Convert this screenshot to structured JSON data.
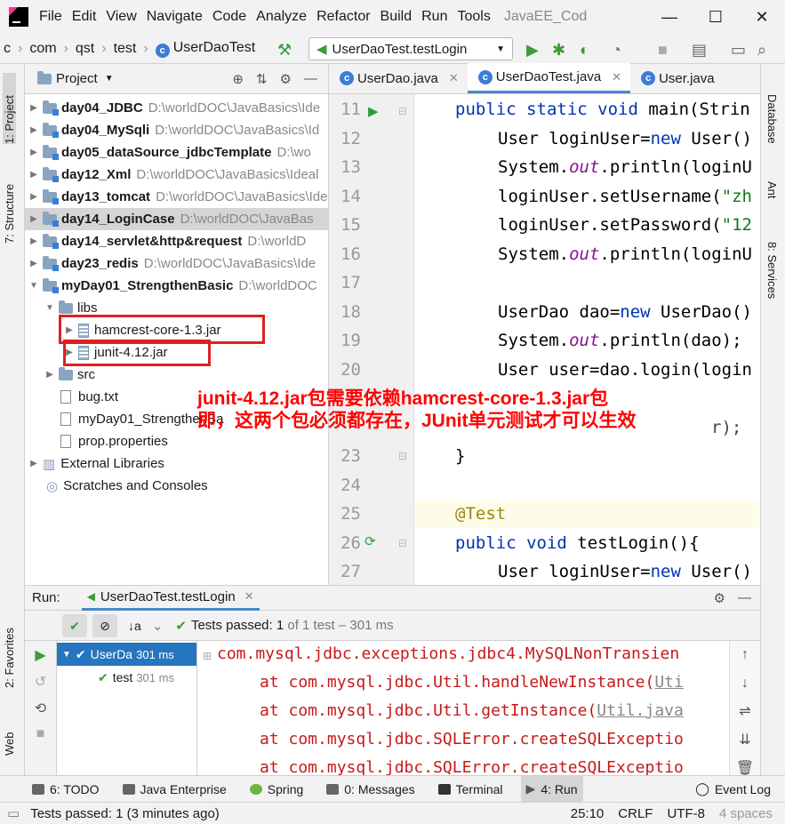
{
  "titlebar": {
    "menu": [
      "File",
      "Edit",
      "View",
      "Navigate",
      "Code",
      "Analyze",
      "Refactor",
      "Build",
      "Run",
      "Tools"
    ],
    "window_title": "JavaEE_Cod",
    "minimize": "—",
    "maximize": "☐",
    "close": "✕"
  },
  "navbar": {
    "crumbs": [
      "c",
      "com",
      "qst",
      "test",
      "UserDaoTest"
    ],
    "run_config": "UserDaoTest.testLogin"
  },
  "left_strip": {
    "project_tab": "1: Project",
    "structure_tab": "7: Structure",
    "favorites_tab": "2: Favorites",
    "web_tab": "Web"
  },
  "right_strip": {
    "database_tab": "Database",
    "ant_tab": "Ant",
    "services_tab": "8: Services"
  },
  "project": {
    "header": "Project",
    "items": [
      {
        "name": "day04_JDBC",
        "path": "D:\\worldDOC\\JavaBasics\\Ide"
      },
      {
        "name": "day04_MySqli",
        "path": "D:\\worldDOC\\JavaBasics\\Id"
      },
      {
        "name": "day05_dataSource_jdbcTemplate",
        "path": "D:\\wo"
      },
      {
        "name": "day12_Xml",
        "path": "D:\\worldDOC\\JavaBasics\\Ideal"
      },
      {
        "name": "day13_tomcat",
        "path": "D:\\worldDOC\\JavaBasics\\Ide"
      },
      {
        "name": "day14_LoginCase",
        "path": "D:\\worldDOC\\JavaBas"
      },
      {
        "name": "day14_servlet&http&request",
        "path": "D:\\worldD"
      },
      {
        "name": "day23_redis",
        "path": "D:\\worldDOC\\JavaBasics\\Ide"
      },
      {
        "name": "myDay01_StrengthenBasic",
        "path": "D:\\worldDOC"
      }
    ],
    "libs": "libs",
    "jar1": "hamcrest-core-1.3.jar",
    "jar2": "junit-4.12.jar",
    "src": "src",
    "bug": "bug.txt",
    "iml": "myDay01_StrengthenBa",
    "prop": "prop.properties",
    "external": "External Libraries",
    "scratches": "Scratches and Consoles"
  },
  "editor": {
    "tabs": [
      "UserDao.java",
      "UserDaoTest.java",
      "User.java"
    ],
    "line_numbers": [
      "11",
      "12",
      "13",
      "14",
      "15",
      "16",
      "17",
      "18",
      "19",
      "20",
      "23",
      "24",
      "25",
      "26",
      "27"
    ],
    "code": {
      "l11a": "public static void ",
      "l11b": "main(Strin",
      "l12a": "User loginUser=",
      "l12b": "new ",
      "l12c": "User()",
      "l13a": "System.",
      "l13b": "out",
      "l13c": ".println(loginU",
      "l14a": "loginUser.setUsername(",
      "l14b": "\"zh",
      "l15a": "loginUser.setPassword(",
      "l15b": "\"12",
      "l16a": "System.",
      "l16b": "out",
      "l16c": ".println(loginU",
      "l18a": "UserDao dao=",
      "l18b": "new ",
      "l18c": "UserDao()",
      "l19a": "System.",
      "l19b": "out",
      "l19c": ".println(dao);",
      "l20": "User user=dao.login(login",
      "l22": "r);",
      "l23": "}",
      "l25": "@Test",
      "l26a": "public void ",
      "l26b": "testLogin(){",
      "l27a": "User loginUser=",
      "l27b": "new ",
      "l27c": "User()"
    }
  },
  "annotation": {
    "line1": "junit-4.12.jar包需要依赖hamcrest-core-1.3.jar包",
    "line2": "即，这两个包必须都存在，JUnit单元测试才可以生效"
  },
  "run": {
    "label": "Run:",
    "tab": "UserDaoTest.testLogin",
    "status_bold": "Tests passed: ",
    "status_count": "1",
    "status_rest": " of 1 test – 301 ms",
    "tree": [
      {
        "name": "UserDa",
        "time": "301 ms"
      },
      {
        "name": "test",
        "time": "301 ms"
      }
    ],
    "console": {
      "c1": "com.mysql.jdbc.exceptions.jdbc4.MySQLNonTransien",
      "c2a": "at com.mysql.jdbc.Util.handleNewInstance(",
      "c2b": "Uti",
      "c3a": "at com.mysql.jdbc.Util.getInstance(",
      "c3b": "Util.java",
      "c4": "at com.mysql.jdbc.SQLError.createSQLExceptio",
      "c5": "at com.mysql.jdbc.SQLError.createSQLExceptio"
    }
  },
  "bottom_tools": [
    "6: TODO",
    "Java Enterprise",
    "Spring",
    "0: Messages",
    "Terminal",
    "4: Run",
    "Event Log"
  ],
  "status": {
    "message": "Tests passed: 1 (3 minutes ago)",
    "position": "25:10",
    "line_sep": "CRLF",
    "encoding": "UTF-8",
    "indent": "4 spaces"
  }
}
